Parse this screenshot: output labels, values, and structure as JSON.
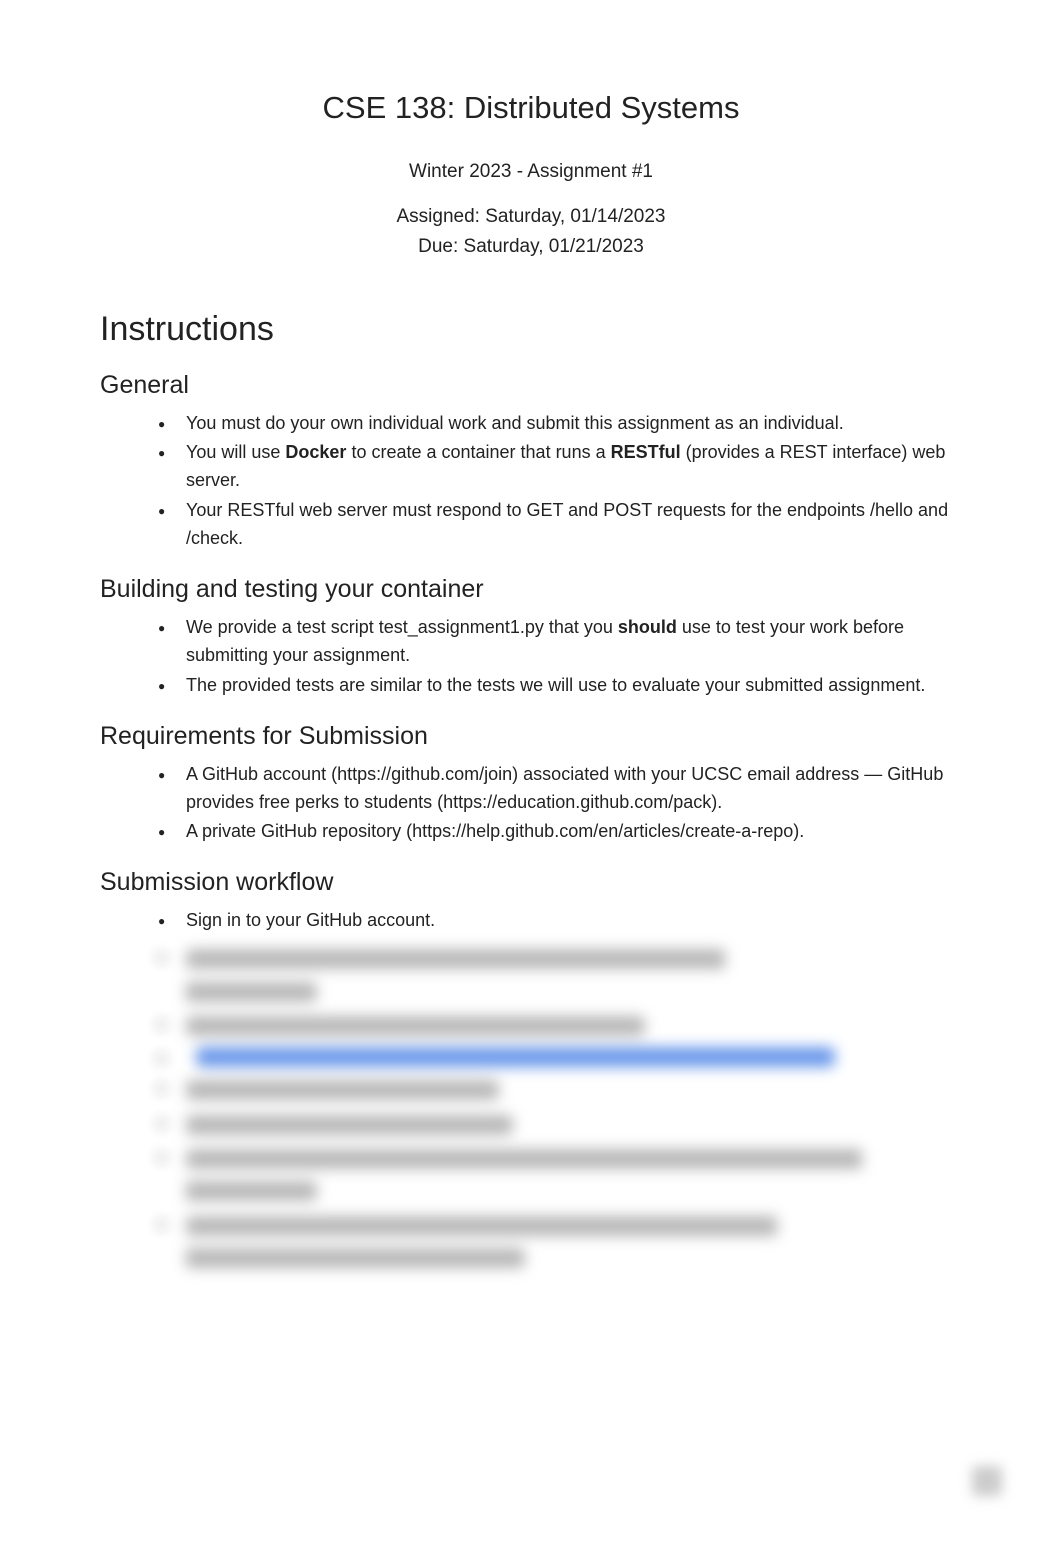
{
  "header": {
    "title": "CSE 138: Distributed Systems",
    "term_line": "Winter 2023 - Assignment #1",
    "assigned_line": "Assigned: Saturday, 01/14/2023",
    "due_line": "Due: Saturday, 01/21/2023"
  },
  "sections": {
    "instructions": {
      "heading": "Instructions"
    },
    "general": {
      "heading": "General",
      "bullet1": "You must do your own individual work and submit this assignment as an individual.",
      "bullet2_pre": "You will use ",
      "bullet2_bold1": "Docker",
      "bullet2_mid": " to create a container that runs a ",
      "bullet2_bold2": "RESTful",
      "bullet2_post": " (provides a REST interface) web server.",
      "bullet3": "Your RESTful web server must respond to GET and POST requests for the endpoints /hello and /check."
    },
    "building": {
      "heading": "Building and testing your container",
      "bullet1_pre": "We provide a test script test_assignment1.py that you ",
      "bullet1_bold": "should",
      "bullet1_post": " use to test your work before submitting your assignment.",
      "bullet2": "The provided tests are similar to the tests we will use to evaluate your submitted assignment."
    },
    "requirements": {
      "heading": "Requirements for Submission",
      "bullet1": "A GitHub account (https://github.com/join) associated with your UCSC email address — GitHub provides free perks to students (https://education.github.com/pack).",
      "bullet2": "A private GitHub repository (https://help.github.com/en/articles/create-a-repo)."
    },
    "submission": {
      "heading": "Submission workflow",
      "bullet1": "Sign in to your GitHub account."
    }
  }
}
